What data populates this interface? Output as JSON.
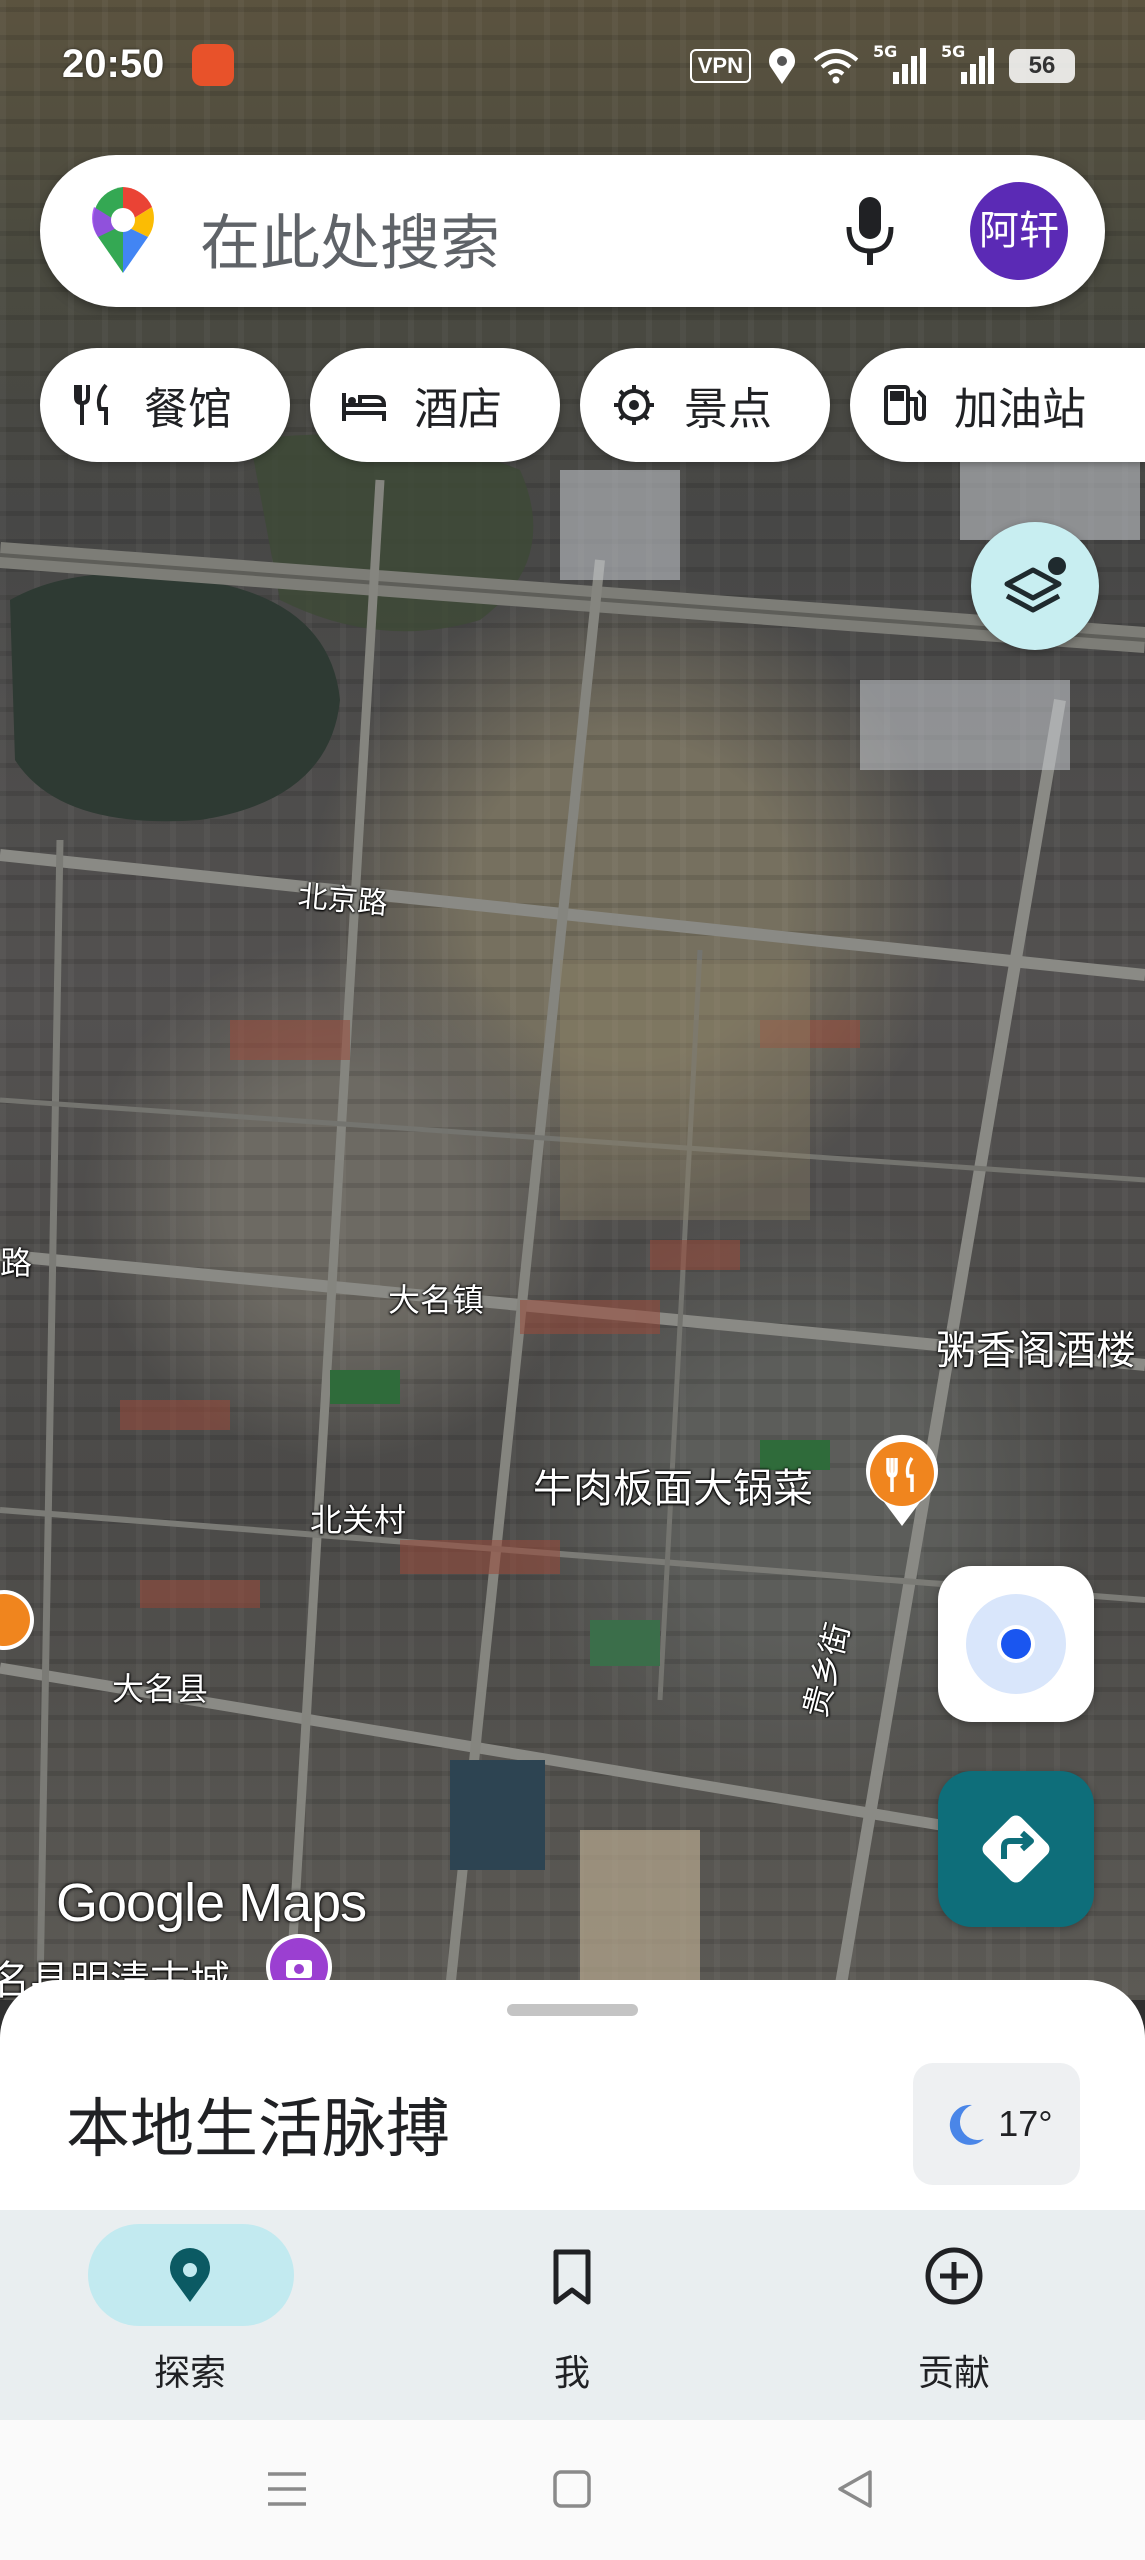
{
  "status_bar": {
    "time": "20:50",
    "vpn_label": "VPN",
    "signal_1": "5G",
    "signal_2": "5G",
    "battery": "56"
  },
  "search": {
    "placeholder": "在此处搜索",
    "avatar_text": "阿轩"
  },
  "chips": [
    {
      "label": "餐馆",
      "icon": "restaurant-icon"
    },
    {
      "label": "酒店",
      "icon": "hotel-icon"
    },
    {
      "label": "景点",
      "icon": "attraction-icon"
    },
    {
      "label": "加油站",
      "icon": "gas-station-icon"
    }
  ],
  "map": {
    "labels": {
      "beijing_road": "北京路",
      "daming_town": "大名镇",
      "beiguan_village": "北关村",
      "daming_county": "大名县",
      "guixiang_street": "贵乡街",
      "left_fragment": "路",
      "old_city_fragment": "名县明清古城"
    },
    "pois": {
      "congee_restaurant": "粥香阁酒楼",
      "beef_noodle": "牛肉板面大锅菜"
    },
    "watermark": "Google Maps"
  },
  "sheet": {
    "title": "本地生活脉搏",
    "temperature": "17°"
  },
  "bottom_nav": [
    {
      "label": "探索",
      "active": true
    },
    {
      "label": "我",
      "active": false
    },
    {
      "label": "贡献",
      "active": false
    }
  ],
  "colors": {
    "accent_teal": "#0e6e7a",
    "active_pill": "#c2eaf0",
    "avatar_bg": "#5b2ab5",
    "poi_orange": "#f0851e",
    "location_blue": "#1a56f0"
  }
}
